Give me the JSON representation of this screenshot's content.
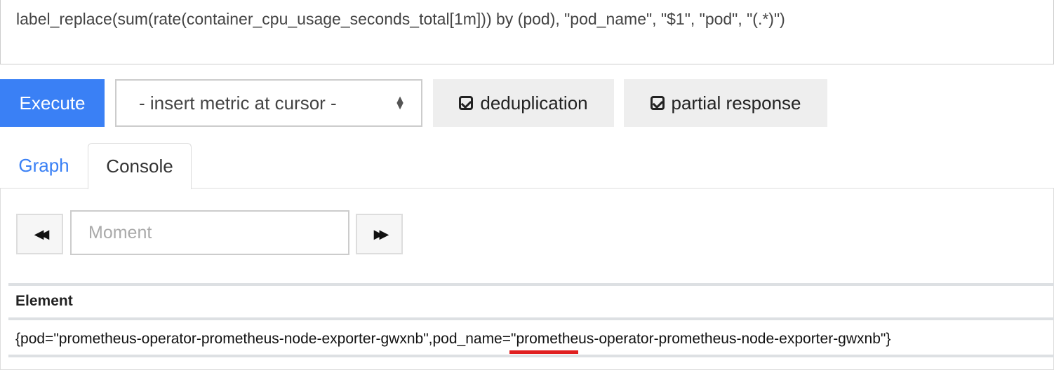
{
  "query": {
    "expression": "label_replace(sum(rate(container_cpu_usage_seconds_total[1m])) by (pod), \"pod_name\",  \"$1\", \"pod\", \"(.*)\")"
  },
  "toolbar": {
    "execute_label": "Execute",
    "metric_select": "- insert metric at cursor -",
    "deduplication_label": "deduplication",
    "partial_response_label": "partial response"
  },
  "tabs": [
    {
      "label": "Graph",
      "active": false
    },
    {
      "label": "Console",
      "active": true
    }
  ],
  "console": {
    "moment_placeholder": "Moment",
    "back_icon": "fast-backward-icon",
    "forward_icon": "fast-forward-icon"
  },
  "table": {
    "header": "Element",
    "rows": [
      "{pod=\"prometheus-operator-prometheus-node-exporter-gwxnb\",pod_name=\"prometheus-operator-prometheus-node-exporter-gwxnb\"}"
    ]
  },
  "colors": {
    "accent": "#3a80f5",
    "annotation_underline": "#e02020"
  }
}
